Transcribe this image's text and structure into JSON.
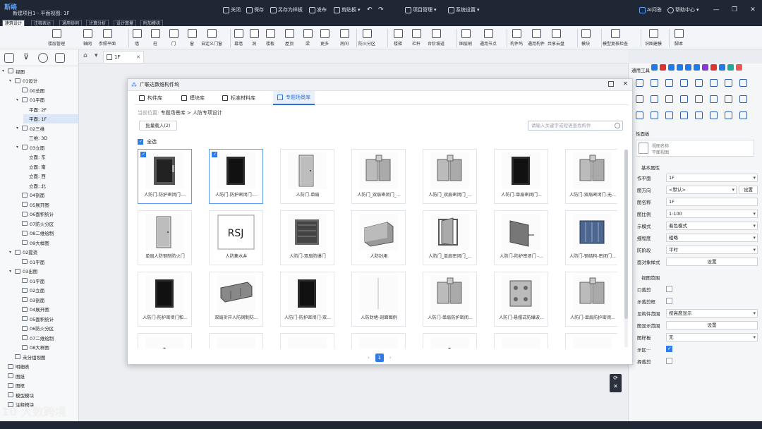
{
  "window": {
    "logo": "斯络",
    "title": "新建项目1 - 平面视图: 1F",
    "menu": [
      "关闭",
      "保存",
      "另存为样板",
      "发布",
      "剪贴板",
      "项目管理",
      "系统设置"
    ],
    "ai": "AI问答",
    "help": "帮助中心"
  },
  "menutabs": [
    "建筑设计",
    "注释表达",
    "通用协同",
    "计算分析",
    "设计算量",
    "附加模块"
  ],
  "ribbon": [
    "楼层管理",
    "轴网",
    "参照平面",
    "墙",
    "柱",
    "门",
    "窗",
    "自定义门窗",
    "幕墙",
    "洞",
    "楼板",
    "屋顶",
    "梁",
    "更多",
    "房间",
    "防火分区",
    "楼梯",
    "栏杆",
    "台阶坡道",
    "图层刷",
    "通用节点",
    "构件坞",
    "通用构件",
    "共享云盘",
    "模块",
    "模型复核检查",
    "识图建模",
    "脚本"
  ],
  "tree": [
    {
      "t": "视图",
      "lvl": 0,
      "c": "▾"
    },
    {
      "t": "01设计",
      "lvl": 1,
      "c": "▾"
    },
    {
      "t": "00总图",
      "lvl": 2,
      "c": ""
    },
    {
      "t": "01平面",
      "lvl": 2,
      "c": "▾"
    },
    {
      "t": "平面: 2F",
      "lvl": 3,
      "c": ""
    },
    {
      "t": "平面: 1F",
      "lvl": 3,
      "c": "",
      "sel": true
    },
    {
      "t": "02三维",
      "lvl": 2,
      "c": "▾"
    },
    {
      "t": "三维: 3D",
      "lvl": 3,
      "c": ""
    },
    {
      "t": "03立面",
      "lvl": 2,
      "c": "▾"
    },
    {
      "t": "立面: 东",
      "lvl": 3,
      "c": ""
    },
    {
      "t": "立面: 南",
      "lvl": 3,
      "c": ""
    },
    {
      "t": "立面: 西",
      "lvl": 3,
      "c": ""
    },
    {
      "t": "立面: 北",
      "lvl": 3,
      "c": ""
    },
    {
      "t": "04剖面",
      "lvl": 2,
      "c": ""
    },
    {
      "t": "05展开图",
      "lvl": 2,
      "c": ""
    },
    {
      "t": "06面积统计",
      "lvl": 2,
      "c": ""
    },
    {
      "t": "07防火分区",
      "lvl": 2,
      "c": ""
    },
    {
      "t": "08二维绘制",
      "lvl": 2,
      "c": ""
    },
    {
      "t": "09大样图",
      "lvl": 2,
      "c": ""
    },
    {
      "t": "02提资",
      "lvl": 1,
      "c": "▾"
    },
    {
      "t": "01平面",
      "lvl": 2,
      "c": ""
    },
    {
      "t": "03出图",
      "lvl": 1,
      "c": "▾"
    },
    {
      "t": "01平面",
      "lvl": 2,
      "c": ""
    },
    {
      "t": "02立面",
      "lvl": 2,
      "c": ""
    },
    {
      "t": "03剖面",
      "lvl": 2,
      "c": ""
    },
    {
      "t": "04展开图",
      "lvl": 2,
      "c": ""
    },
    {
      "t": "05面积统计",
      "lvl": 2,
      "c": ""
    },
    {
      "t": "06防火分区",
      "lvl": 2,
      "c": ""
    },
    {
      "t": "07二维绘制",
      "lvl": 2,
      "c": ""
    },
    {
      "t": "08大样图",
      "lvl": 2,
      "c": ""
    },
    {
      "t": "未分组视图",
      "lvl": 1,
      "c": ""
    },
    {
      "t": "明细表",
      "lvl": 0,
      "c": ""
    },
    {
      "t": "图纸",
      "lvl": 0,
      "c": ""
    },
    {
      "t": "图框",
      "lvl": 0,
      "c": ""
    },
    {
      "t": "模型模块",
      "lvl": 0,
      "c": ""
    },
    {
      "t": "注释模块",
      "lvl": 0,
      "c": ""
    }
  ],
  "canvas_tab": "1F",
  "modal": {
    "title": "广联达数维构件坞",
    "tabs": [
      "构件库",
      "模块库",
      "标准材料库",
      "专题场景库"
    ],
    "crumb_pre": "当前位置:",
    "crumb_a": "专题场景库",
    "crumb_sep": ">",
    "crumb_b": "人防专项设计",
    "batch": "批量载入(2)",
    "search_ph": "请输入关键字或短语查找构件",
    "selall": "全选",
    "page": "1",
    "items": [
      {
        "n": "人防门-防护密闭门-...",
        "sel": true,
        "k": "double"
      },
      {
        "n": "人防门-防护密闭门-...",
        "sel": true,
        "k": "black"
      },
      {
        "n": "人防门-单扇",
        "sel": false,
        "k": "single"
      },
      {
        "n": "人防门_双扇密闭门_...",
        "sel": false,
        "k": "frame"
      },
      {
        "n": "人防门_双扇密闭门_...",
        "sel": false,
        "k": "frame"
      },
      {
        "n": "人防门-单扇密闭门...",
        "sel": false,
        "k": "black"
      },
      {
        "n": "人防门-双扇密闭门-无...",
        "sel": false,
        "k": "frame"
      },
      {
        "n": "单扇人防钢制防火门",
        "sel": false,
        "k": "single"
      },
      {
        "n": "人防集水井",
        "sel": false,
        "k": "text",
        "txt": "RSJ"
      },
      {
        "n": "人防门-双扇防爆门",
        "sel": false,
        "k": "grate"
      },
      {
        "n": "人防封堵",
        "sel": false,
        "k": "block"
      },
      {
        "n": "人防门_单扇密闭门_...",
        "sel": false,
        "k": "open"
      },
      {
        "n": "人防门-防护密闭门 -...",
        "sel": false,
        "k": "panel"
      },
      {
        "n": "人防门-钢结构-密闭门...",
        "sel": false,
        "k": "blue"
      },
      {
        "n": "人防门-防护密闭门和...",
        "sel": false,
        "k": "black"
      },
      {
        "n": "双扇折开人防钢制防...",
        "sel": false,
        "k": "slab"
      },
      {
        "n": "人防门-防护密闭门-双...",
        "sel": false,
        "k": "black"
      },
      {
        "n": "人防封堵-剖面图例",
        "sel": false,
        "k": "line"
      },
      {
        "n": "人防门-单扇防护密闭...",
        "sel": false,
        "k": "frame"
      },
      {
        "n": "人防门-悬摆式防爆波...",
        "sel": false,
        "k": "multi"
      },
      {
        "n": "人防门-单扇防护密闭...",
        "sel": false,
        "k": "frame"
      },
      {
        "n": "",
        "sel": false,
        "k": "roof"
      },
      {
        "n": "",
        "sel": false,
        "k": "blank"
      },
      {
        "n": "",
        "sel": false,
        "k": "small"
      },
      {
        "n": "",
        "sel": false,
        "k": "small"
      },
      {
        "n": "",
        "sel": false,
        "k": "roof"
      },
      {
        "n": "",
        "sel": false,
        "k": "small"
      },
      {
        "n": "",
        "sel": false,
        "k": "small"
      }
    ]
  },
  "right": {
    "toolbox": "通用工具",
    "propbox": "性面板",
    "viewname": "视图名称",
    "viewtype": "平面视图",
    "section": "基本属性",
    "rows": [
      {
        "k": "作平面",
        "v": "1F",
        "t": "dd"
      },
      {
        "k": "图方向",
        "v": "<默认>",
        "t": "dd2",
        "btn": "设置"
      },
      {
        "k": "图名称",
        "v": "1F",
        "t": "txt"
      },
      {
        "k": "图比例",
        "v": "1:100",
        "t": "dd"
      },
      {
        "k": "示模式",
        "v": "着色模式",
        "t": "dd"
      },
      {
        "k": "细程度",
        "v": "粗略",
        "t": "dd"
      },
      {
        "k": "防阶段",
        "v": "平时",
        "t": "dd"
      },
      {
        "k": "面对象样式",
        "v": "设置",
        "t": "btn"
      }
    ],
    "section2": "视图范围",
    "rows2": [
      {
        "k": "口裁剪",
        "v": "",
        "t": "chk"
      },
      {
        "k": "示裁剪框",
        "v": "",
        "t": "chk"
      },
      {
        "k": "见构件范围",
        "v": "按高度显示",
        "t": "dd"
      },
      {
        "k": "图显示范围",
        "v": "设置",
        "t": "btn"
      },
      {
        "k": "图样板",
        "v": "无",
        "t": "dd"
      },
      {
        "k": "示区···",
        "v": "",
        "t": "chkon"
      },
      {
        "k": "择裁剪",
        "v": "",
        "t": "chk"
      }
    ]
  },
  "watermark": "10 大数跨境"
}
